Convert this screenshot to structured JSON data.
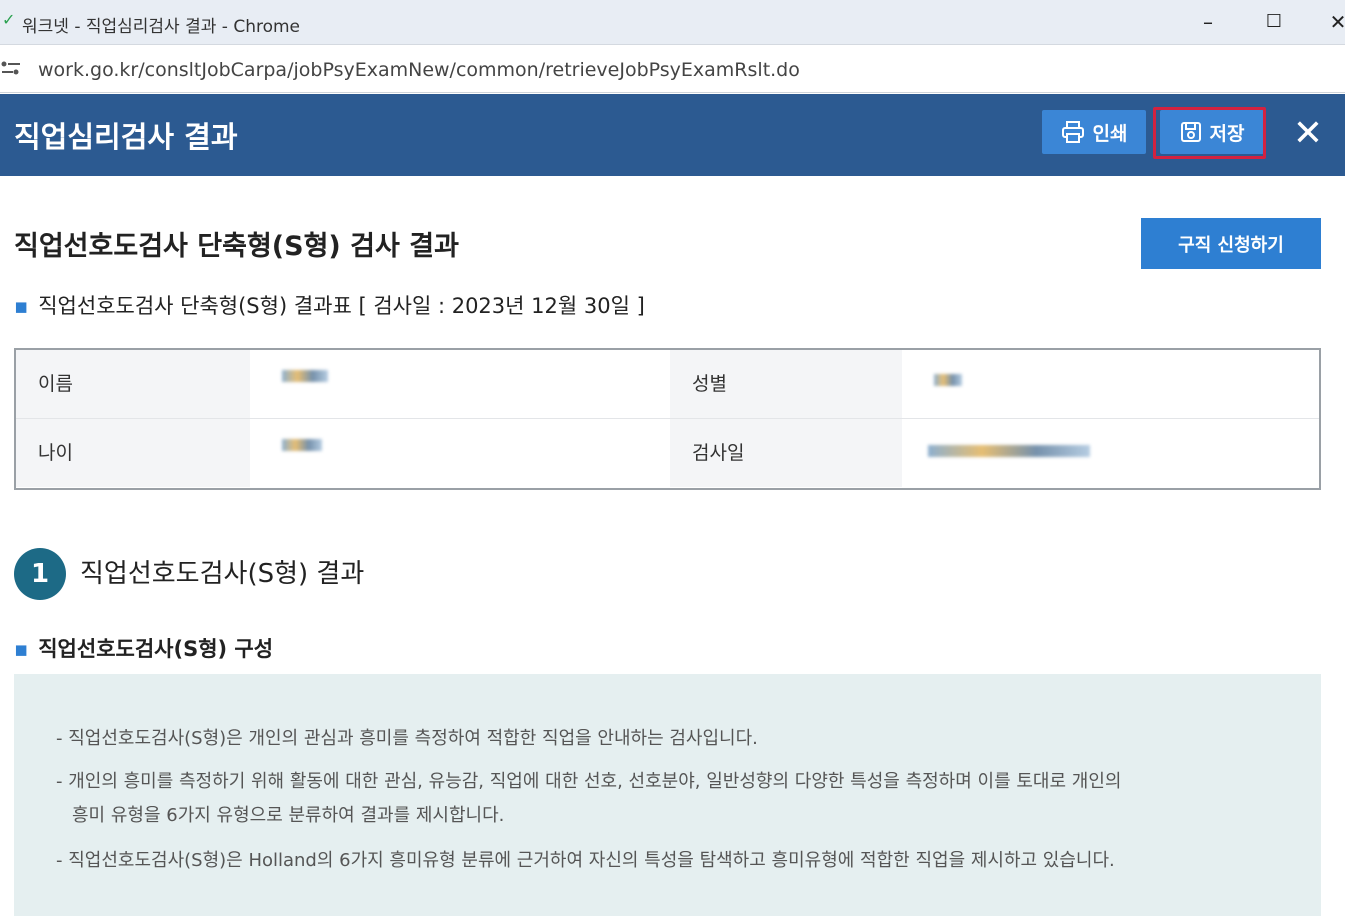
{
  "window": {
    "title": "워크넷 - 직업심리검사 결과 - Chrome",
    "minimize": "–",
    "maximize": "☐",
    "close": "✕"
  },
  "address": {
    "url": "work.go.kr/consltJobCarpa/jobPsyExamNew/common/retrieveJobPsyExamRslt.do"
  },
  "header": {
    "title": "직업심리검사 결과",
    "print_label": "인쇄",
    "save_label": "저장",
    "close_glyph": "✕"
  },
  "main": {
    "page_title": "직업선호도검사 단축형(S형) 검사 결과",
    "apply_button": "구직 신청하기",
    "result_table_caption": "직업선호도검사 단축형(S형) 결과표 [ 검사일 : 2023년 12월 30일 ]",
    "info": {
      "name_label": "이름",
      "gender_label": "성별",
      "age_label": "나이",
      "exam_date_label": "검사일"
    },
    "section": {
      "number": "1",
      "title": "직업선호도검사(S형) 결과",
      "sub_title": "직업선호도검사(S형) 구성",
      "description": [
        "- 직업선호도검사(S형)은 개인의 관심과 흥미를 측정하여 적합한 직업을 안내하는 검사입니다.",
        "- 개인의 흥미를 측정하기 위해 활동에 대한 관심, 유능감, 직업에 대한 선호, 선호분야, 일반성향의 다양한 특성을 측정하며 이를 토대로 개인의",
        "흥미 유형을 6가지 유형으로 분류하여 결과를 제시합니다.",
        "- 직업선호도검사(S형)은 Holland의 6가지 흥미유형 분류에 근거하여 자신의 특성을 탐색하고 흥미유형에 적합한 직업을 제시하고 있습니다."
      ]
    }
  }
}
